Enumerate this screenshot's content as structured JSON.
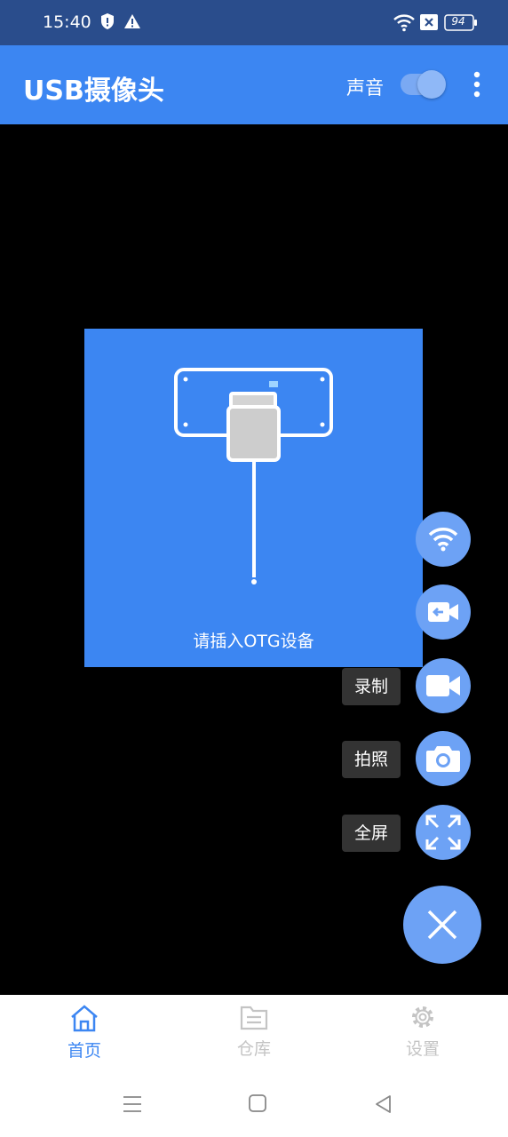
{
  "status_bar": {
    "time": "15:40",
    "battery": "94",
    "icons": [
      "shield-icon",
      "warning-icon",
      "wifi-icon",
      "no-sim-icon",
      "battery-icon"
    ]
  },
  "app_bar": {
    "title": "USB摄像头",
    "sound_label": "声音",
    "sound_enabled": true
  },
  "camera": {
    "otg_prompt": "请插入OTG设备"
  },
  "fabs": [
    {
      "icon": "wifi-icon",
      "label": ""
    },
    {
      "icon": "switch-camera-icon",
      "label": ""
    },
    {
      "icon": "video-camera-icon",
      "label": "录制"
    },
    {
      "icon": "camera-icon",
      "label": "拍照"
    },
    {
      "icon": "fullscreen-icon",
      "label": "全屏"
    }
  ],
  "bottom_nav": {
    "items": [
      {
        "label": "首页",
        "icon": "home-icon",
        "active": true
      },
      {
        "label": "仓库",
        "icon": "folder-icon",
        "active": false
      },
      {
        "label": "设置",
        "icon": "gear-icon",
        "active": false
      }
    ]
  },
  "colors": {
    "primary": "#3c86f2",
    "status_bar": "#2a4d8c",
    "fab": "#6da2f5",
    "label_bg": "#333333"
  }
}
